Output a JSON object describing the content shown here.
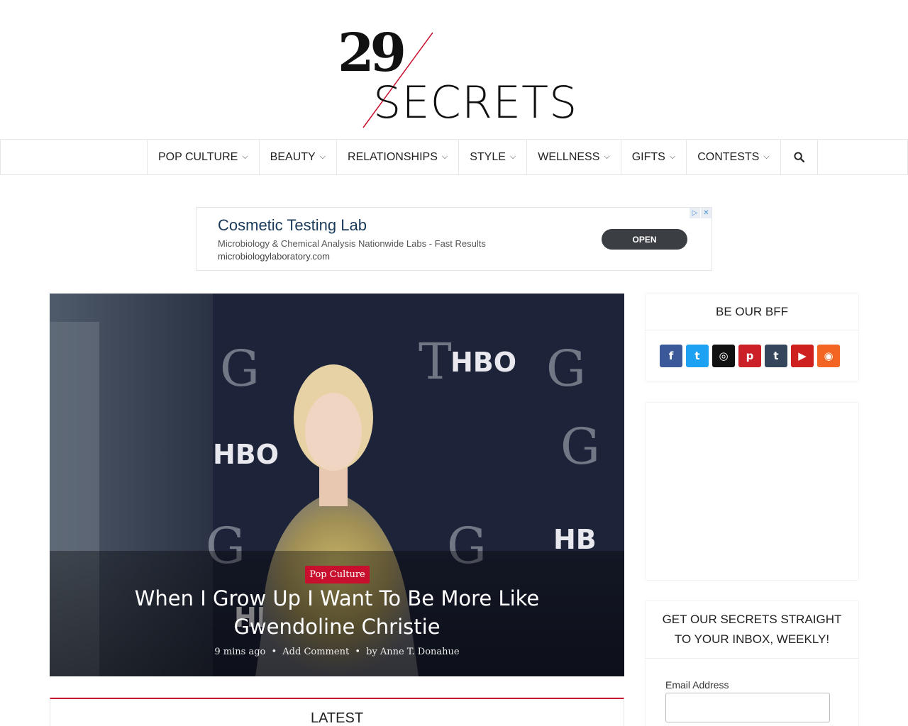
{
  "logo": {
    "number": "29",
    "word": "SECRETS"
  },
  "nav": {
    "items": [
      {
        "label": "POP CULTURE"
      },
      {
        "label": "BEAUTY"
      },
      {
        "label": "RELATIONSHIPS"
      },
      {
        "label": "STYLE"
      },
      {
        "label": "WELLNESS"
      },
      {
        "label": "GIFTS"
      },
      {
        "label": "CONTESTS"
      }
    ],
    "search_icon": "search-icon"
  },
  "ad": {
    "title": "Cosmetic Testing Lab",
    "description": "Microbiology & Chemical Analysis Nationwide Labs - Fast Results",
    "url": "microbiologylaboratory.com",
    "cta": "OPEN"
  },
  "hero": {
    "category": "Pop Culture",
    "title": "When I Grow Up I Want To Be More Like Gwendoline Christie",
    "time": "9 mins ago",
    "comments": "Add Comment",
    "by": "by",
    "author": "Anne T. Donahue",
    "separator": "•"
  },
  "latest": {
    "title": "LATEST"
  },
  "sidebar": {
    "bff_title": "BE OUR BFF",
    "socials": [
      {
        "icon": "facebook-icon",
        "glyph": "f",
        "color": "#3b5998"
      },
      {
        "icon": "twitter-icon",
        "glyph": "t",
        "color": "#1da1f2"
      },
      {
        "icon": "instagram-icon",
        "glyph": "◎",
        "color": "#111111"
      },
      {
        "icon": "pinterest-icon",
        "glyph": "p",
        "color": "#cb2027"
      },
      {
        "icon": "tumblr-icon",
        "glyph": "t",
        "color": "#35465c"
      },
      {
        "icon": "youtube-icon",
        "glyph": "▶",
        "color": "#cd201f"
      },
      {
        "icon": "rss-icon",
        "glyph": "◉",
        "color": "#f26522"
      }
    ],
    "newsletter_title": "GET OUR SECRETS STRAIGHT TO YOUR INBOX, WEEKLY!",
    "email_label": "Email Address"
  },
  "colors": {
    "accent": "#c8102e"
  }
}
